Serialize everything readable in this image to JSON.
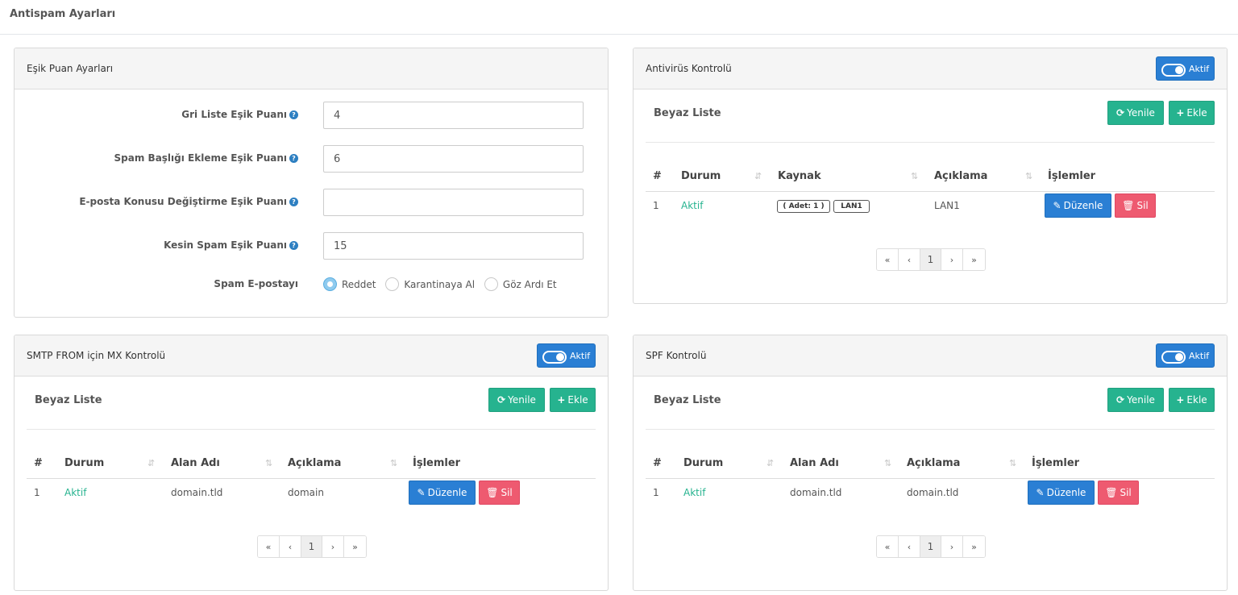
{
  "page": {
    "title": "Antispam Ayarları"
  },
  "threshold": {
    "title": "Eşik Puan Ayarları",
    "fields": [
      {
        "label": "Gri Liste Eşik Puanı",
        "value": "4"
      },
      {
        "label": "Spam Başlığı Ekleme Eşik Puanı",
        "value": "6"
      },
      {
        "label": "E-posta Konusu Değiştirme Eşik Puanı",
        "value": ""
      },
      {
        "label": "Kesin Spam Eşik Puanı",
        "value": "15"
      }
    ],
    "radio_label": "Spam E-postayı",
    "radio_options": [
      "Reddet",
      "Karantinaya Al",
      "Göz Ardı Et"
    ],
    "radio_selected": "Reddet"
  },
  "antivirus": {
    "title": "Antivirüs Kontrolü",
    "toggle": "Aktif",
    "list_title": "Beyaz Liste",
    "refresh": "Yenile",
    "add": "Ekle",
    "columns": [
      "#",
      "Durum",
      "Kaynak",
      "Açıklama",
      "İşlemler"
    ],
    "rows": [
      {
        "no": "1",
        "status": "Aktif",
        "tags": [
          "( Adet: 1 )",
          "LAN1"
        ],
        "desc": "LAN1",
        "edit": "Düzenle",
        "delete": "Sil"
      }
    ],
    "pager": [
      "«",
      "‹",
      "1",
      "›",
      "»"
    ]
  },
  "smtp": {
    "title": "SMTP FROM için MX Kontrolü",
    "toggle": "Aktif",
    "list_title": "Beyaz Liste",
    "refresh": "Yenile",
    "add": "Ekle",
    "columns": [
      "#",
      "Durum",
      "Alan Adı",
      "Açıklama",
      "İşlemler"
    ],
    "rows": [
      {
        "no": "1",
        "status": "Aktif",
        "domain": "domain.tld",
        "desc": "domain",
        "edit": "Düzenle",
        "delete": "Sil"
      }
    ],
    "pager": [
      "«",
      "‹",
      "1",
      "›",
      "»"
    ]
  },
  "spf": {
    "title": "SPF Kontrolü",
    "toggle": "Aktif",
    "list_title": "Beyaz Liste",
    "refresh": "Yenile",
    "add": "Ekle",
    "columns": [
      "#",
      "Durum",
      "Alan Adı",
      "Açıklama",
      "İşlemler"
    ],
    "rows": [
      {
        "no": "1",
        "status": "Aktif",
        "domain": "domain.tld",
        "desc": "domain.tld",
        "edit": "Düzenle",
        "delete": "Sil"
      }
    ],
    "pager": [
      "«",
      "‹",
      "1",
      "›",
      "»"
    ]
  },
  "icons": {
    "help": "question-circle-icon",
    "refresh": "refresh-icon",
    "add": "plus-icon",
    "edit": "edit-icon",
    "delete": "trash-icon",
    "sort": "sort-icon"
  },
  "colors": {
    "primary": "#2a7fd4",
    "success": "#26b38f",
    "danger": "#ee5a70"
  }
}
